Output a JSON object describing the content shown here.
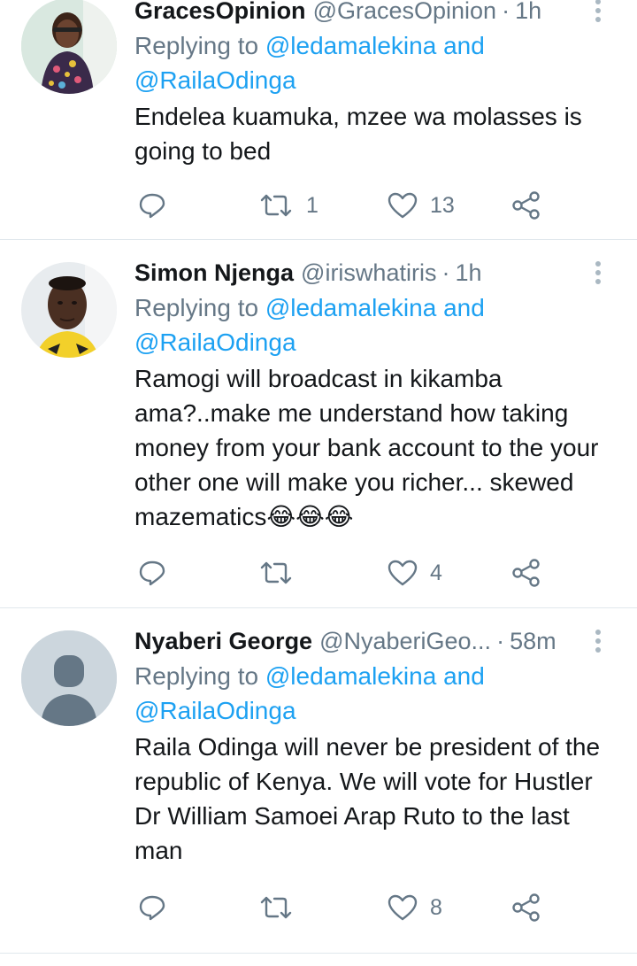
{
  "tweets": [
    {
      "name": "GracesOpinion",
      "handle": "@GracesOpinion",
      "time": "1h",
      "replying_prefix": "Replying to",
      "replying_to_1": "@ledamalekina",
      "replying_and": "and",
      "replying_to_2": "@RailaOdinga",
      "text": "Endelea kuamuka, mzee wa molasses is going to bed",
      "retweets": "1",
      "likes": "13"
    },
    {
      "name": "Simon Njenga",
      "handle": "@iriswhatiris",
      "time": "1h",
      "replying_prefix": "Replying to",
      "replying_to_1": "@ledamalekina",
      "replying_and": "and",
      "replying_to_2": "@RailaOdinga",
      "text": "Ramogi will broadcast in kikamba ama?..make me understand how taking money from your bank account to the your other one will make you richer... skewed mazematics😂😂😂",
      "retweets": "",
      "likes": "4"
    },
    {
      "name": "Nyaberi George",
      "handle": "@NyaberiGeo...",
      "time": "58m",
      "replying_prefix": "Replying to",
      "replying_to_1": "@ledamalekina",
      "replying_and": "and",
      "replying_to_2": "@RailaOdinga",
      "text": "Raila Odinga will never be president of the republic of Kenya. We will vote for Hustler Dr William Samoei Arap Ruto to the last man",
      "retweets": "",
      "likes": "8"
    }
  ],
  "separator": "·",
  "colors": {
    "link": "#1da1f2",
    "muted": "#657786",
    "text": "#14171a",
    "divider": "#e1e8ed"
  }
}
